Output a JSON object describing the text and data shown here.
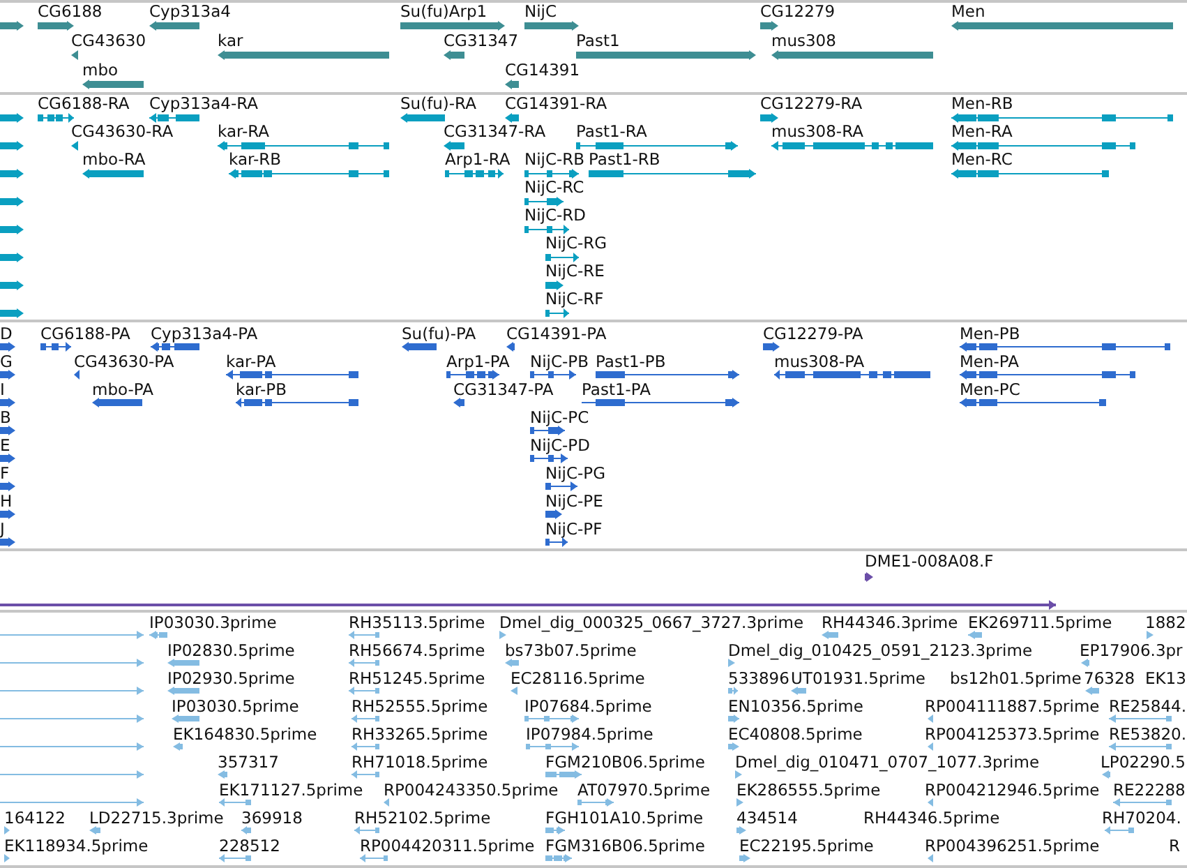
{
  "tracks": [
    {
      "color": "#3e8e93",
      "features": [
        {
          "reverse": false
        },
        {
          "label": "CG6188",
          "reverse": false
        },
        {
          "label": "Cyp313a4",
          "reverse": true
        },
        {
          "label": "Su(fu)Arp1",
          "reverse": false
        },
        {
          "label": "NijC",
          "reverse": false
        },
        {
          "label": "CG12279",
          "reverse": false
        },
        {
          "label": "Men",
          "reverse": true
        },
        {
          "label": "CG43630",
          "reverse": true
        },
        {
          "label": "kar",
          "reverse": true
        },
        {
          "label": "CG31347",
          "reverse": true
        },
        {
          "label": "Past1",
          "reverse": false
        },
        {
          "label": "mus308",
          "reverse": true
        },
        {
          "label": "mbo",
          "reverse": true
        },
        {
          "label": "CG14391",
          "reverse": true
        }
      ]
    },
    {
      "color": "#0a9fc0",
      "features": [
        {
          "reverse": false
        },
        {
          "label": "CG6188-RA",
          "reverse": false
        },
        {
          "label": "Cyp313a4-RA",
          "reverse": true
        },
        {
          "label": "Su(fu)-RA",
          "reverse": true
        },
        {
          "label": "CG14391-RA",
          "reverse": true
        },
        {
          "label": "CG12279-RA",
          "reverse": false
        },
        {
          "label": "Men-RB",
          "reverse": true
        },
        {
          "reverse": false
        },
        {
          "label": "CG43630-RA",
          "reverse": true
        },
        {
          "label": "kar-RA",
          "reverse": true
        },
        {
          "label": "CG31347-RA",
          "reverse": true
        },
        {
          "label": "Past1-RA",
          "reverse": false
        },
        {
          "label": "mus308-RA",
          "reverse": true
        },
        {
          "label": "Men-RA",
          "reverse": true
        },
        {
          "reverse": false
        },
        {
          "label": "mbo-RA",
          "reverse": true
        },
        {
          "label": "kar-RB",
          "reverse": true
        },
        {
          "label": "Arp1-RA",
          "reverse": false
        },
        {
          "label": "NijC-RB",
          "reverse": false
        },
        {
          "label": "Past1-RB",
          "reverse": false
        },
        {
          "label": "Men-RC",
          "reverse": true
        },
        {
          "reverse": false
        },
        {
          "label": "NijC-RC",
          "reverse": false
        },
        {
          "reverse": false
        },
        {
          "label": "NijC-RD",
          "reverse": false
        },
        {
          "reverse": false
        },
        {
          "label": "NijC-RG",
          "reverse": false
        },
        {
          "reverse": false
        },
        {
          "label": "NijC-RE",
          "reverse": false
        },
        {
          "reverse": false
        },
        {
          "label": "NijC-RF",
          "reverse": false
        }
      ]
    },
    {
      "color": "#2e6ccf",
      "features": [
        {
          "label": "D",
          "reverse": false
        },
        {
          "label": "CG6188-PA",
          "reverse": false
        },
        {
          "label": "Cyp313a4-PA",
          "reverse": true
        },
        {
          "label": "Su(fu)-PA",
          "reverse": true
        },
        {
          "label": "CG14391-PA",
          "reverse": true
        },
        {
          "label": "CG12279-PA",
          "reverse": false
        },
        {
          "label": "Men-PB",
          "reverse": true
        },
        {
          "label": "G",
          "reverse": false
        },
        {
          "label": "CG43630-PA",
          "reverse": true
        },
        {
          "label": "kar-PA",
          "reverse": true
        },
        {
          "label": "Arp1-PA",
          "reverse": false
        },
        {
          "label": "NijC-PB",
          "reverse": false
        },
        {
          "label": "Past1-PB",
          "reverse": false
        },
        {
          "label": "mus308-PA",
          "reverse": true
        },
        {
          "label": "Men-PA",
          "reverse": true
        },
        {
          "label": "I",
          "reverse": false
        },
        {
          "label": "mbo-PA",
          "reverse": true
        },
        {
          "label": "kar-PB",
          "reverse": true
        },
        {
          "label": "CG31347-PA",
          "reverse": true
        },
        {
          "label": "Past1-PA",
          "reverse": false
        },
        {
          "label": "Men-PC",
          "reverse": true
        },
        {
          "label": "B",
          "reverse": false
        },
        {
          "label": "NijC-PC",
          "reverse": false
        },
        {
          "label": "E",
          "reverse": false
        },
        {
          "label": "NijC-PD",
          "reverse": false
        },
        {
          "label": "F",
          "reverse": false
        },
        {
          "label": "NijC-PG",
          "reverse": false
        },
        {
          "label": "H",
          "reverse": false
        },
        {
          "label": "NijC-PE",
          "reverse": false
        },
        {
          "label": "J",
          "reverse": false
        },
        {
          "label": "NijC-PF",
          "reverse": false
        }
      ]
    },
    {
      "color": "#6b4ea8",
      "features": [
        {
          "label": "DME1-008A08.F",
          "reverse": false
        },
        {
          "reverse": false
        }
      ]
    },
    {
      "color": "#84bce2",
      "features": [
        {
          "reverse": false
        },
        {
          "label": "IP03030.3prime",
          "reverse": true
        },
        {
          "label": "RH35113.5prime",
          "reverse": true
        },
        {
          "label": "Dmel_dig_000325_0667_3727.3prime",
          "reverse": false
        },
        {
          "label": "RH44346.3prime",
          "reverse": true
        },
        {
          "label": "EK269711.5prime",
          "reverse": true
        },
        {
          "label": "1882",
          "reverse": false
        },
        {
          "reverse": false
        },
        {
          "label": "IP02830.5prime",
          "reverse": true
        },
        {
          "label": "RH56674.5prime",
          "reverse": true
        },
        {
          "label": "bs73b07.5prime",
          "reverse": true
        },
        {
          "label": "Dmel_dig_010425_0591_2123.3prime",
          "reverse": false
        },
        {
          "label": "EP17906.3pr",
          "reverse": true
        },
        {
          "reverse": false
        },
        {
          "label": "IP02930.5prime",
          "reverse": true
        },
        {
          "label": "RH51245.5prime",
          "reverse": true
        },
        {
          "label": "EC28116.5prime",
          "reverse": true
        },
        {
          "label": "533896",
          "reverse": false
        },
        {
          "label": "UT01931.5prime",
          "reverse": true
        },
        {
          "label": "bs12h01.5prime"
        },
        {
          "label": "76328",
          "reverse": true
        },
        {
          "label": "EK13"
        },
        {
          "reverse": false
        },
        {
          "label": "IP03030.5prime",
          "reverse": true
        },
        {
          "label": "RH52555.5prime",
          "reverse": true
        },
        {
          "label": "IP07684.5prime",
          "reverse": false
        },
        {
          "label": "EN10356.5prime",
          "reverse": false
        },
        {
          "label": "RP004111887.5prime",
          "reverse": true
        },
        {
          "label": "RE25844.",
          "reverse": true
        },
        {
          "reverse": false
        },
        {
          "label": "EK164830.5prime",
          "reverse": true
        },
        {
          "label": "RH33265.5prime",
          "reverse": true
        },
        {
          "label": "IP07984.5prime",
          "reverse": false
        },
        {
          "label": "EC40808.5prime",
          "reverse": false
        },
        {
          "label": "RP004125373.5prime",
          "reverse": true
        },
        {
          "label": "RE53820.",
          "reverse": true
        },
        {
          "reverse": false
        },
        {
          "label": "357317",
          "reverse": true
        },
        {
          "label": "RH71018.5prime",
          "reverse": true
        },
        {
          "label": "FGM210B06.5prime",
          "reverse": false
        },
        {
          "label": "Dmel_dig_010471_0707_1077.3prime",
          "reverse": false
        },
        {
          "label": "LP02290.5",
          "reverse": true
        },
        {
          "reverse": false
        },
        {
          "label": "EK171127.5prime",
          "reverse": true
        },
        {
          "label": "RP004243350.5prime",
          "reverse": true
        },
        {
          "label": "AT07970.5prime",
          "reverse": false
        },
        {
          "label": "EK286555.5prime",
          "reverse": false
        },
        {
          "label": "RP004212946.5prime",
          "reverse": true
        },
        {
          "label": "RE22288",
          "reverse": true
        },
        {
          "label": "164122",
          "reverse": false
        },
        {
          "label": "LD22715.3prime",
          "reverse": true
        },
        {
          "label": "369918",
          "reverse": true
        },
        {
          "label": "RH52102.5prime",
          "reverse": true
        },
        {
          "label": "FGH101A10.5prime",
          "reverse": false
        },
        {
          "label": "434514",
          "reverse": false
        },
        {
          "label": "RH44346.5prime"
        },
        {
          "label": "RH70204.",
          "reverse": true
        },
        {
          "label": "EK118934.5prime",
          "reverse": false
        },
        {
          "label": "228512",
          "reverse": true
        },
        {
          "label": "RP004420311.5prime",
          "reverse": true
        },
        {
          "label": "FGM316B06.5prime",
          "reverse": false
        },
        {
          "label": "EC22195.5prime",
          "reverse": false
        },
        {
          "label": "RP004396251.5prime",
          "reverse": true
        },
        {
          "label": "R"
        }
      ]
    }
  ]
}
